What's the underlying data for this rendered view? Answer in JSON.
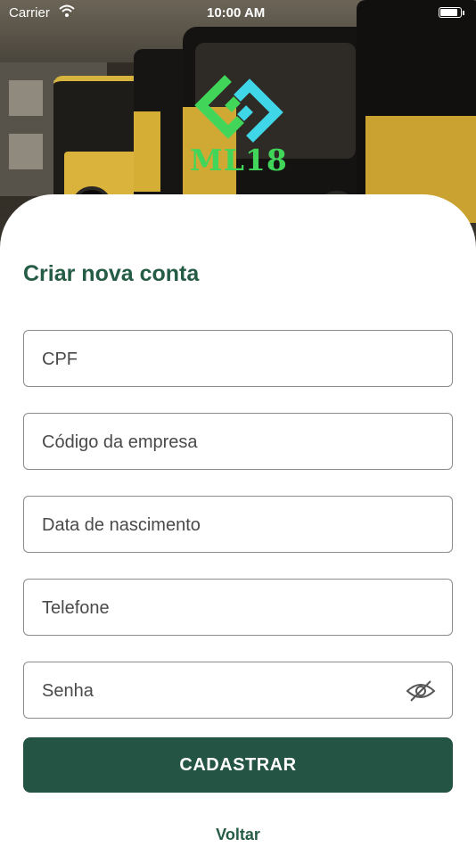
{
  "status_bar": {
    "carrier": "Carrier",
    "time": "10:00 AM"
  },
  "logo": {
    "text": "ML18",
    "colors": {
      "green": "#41d65a",
      "cyan": "#3fd6e8"
    }
  },
  "form": {
    "title": "Criar nova conta",
    "fields": [
      {
        "placeholder": "CPF"
      },
      {
        "placeholder": "Código da empresa"
      },
      {
        "placeholder": "Data de nascimento"
      },
      {
        "placeholder": "Telefone"
      },
      {
        "placeholder": "Senha",
        "icon": "eye-off-icon"
      }
    ],
    "submit_label": "CADASTRAR",
    "back_label": "Voltar"
  },
  "theme": {
    "primary": "#245443",
    "title": "#255c45",
    "border": "#8c8c8c"
  }
}
